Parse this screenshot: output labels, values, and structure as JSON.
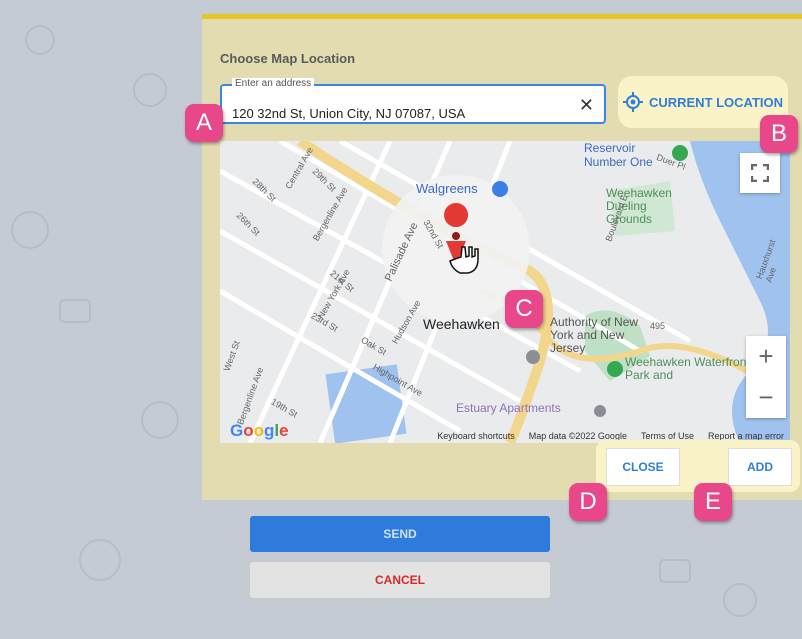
{
  "dialog": {
    "title": "Choose Map Location",
    "address_label": "Enter an address",
    "address_value": "120 32nd St, Union City, NJ 07087, USA",
    "clear_icon": "close-icon",
    "current_location_label": "CURRENT LOCATION",
    "current_location_icon": "crosshair-icon",
    "close_label": "CLOSE",
    "add_label": "ADD"
  },
  "map": {
    "labels": {
      "walgreens": "Walgreens",
      "weehawken": "Weehawken",
      "dueling": "Weehawken Dueling Grounds",
      "reservoir": "Reservoir Number One",
      "port_authority": "Authority of New York and New Jersey",
      "waterfront": "Weehawken Waterfront Park and",
      "estuary": "Estuary Apartments",
      "palisade": "Palisade Ave",
      "st32": "32nd St",
      "st29": "29th St",
      "st28": "28th St",
      "st26": "26th St",
      "st23": "23rd St",
      "st21": "21st St",
      "st19": "19th St",
      "central": "Central Ave",
      "bergenline": "Bergenline Ave",
      "ny_ave": "New York Ave",
      "hudson": "Hudson Ave",
      "oak": "Oak St",
      "highpoint": "Highpoint Ave",
      "west": "West St",
      "bergenline2": "Bergenline Ave",
      "hwy495": "495",
      "duer": "Duer Pl",
      "boulevard": "Boulevard E",
      "hauxhurst": "Hauxhurst Ave"
    },
    "google": "Google",
    "footer": [
      "Keyboard shortcuts",
      "Map data ©2022 Google",
      "Terms of Use",
      "Report a map error"
    ],
    "zoom_in": "+",
    "zoom_out": "−"
  },
  "actions": {
    "send_label": "SEND",
    "cancel_label": "CANCEL"
  },
  "badges": {
    "a": "A",
    "b": "B",
    "c": "C",
    "d": "D",
    "e": "E"
  }
}
